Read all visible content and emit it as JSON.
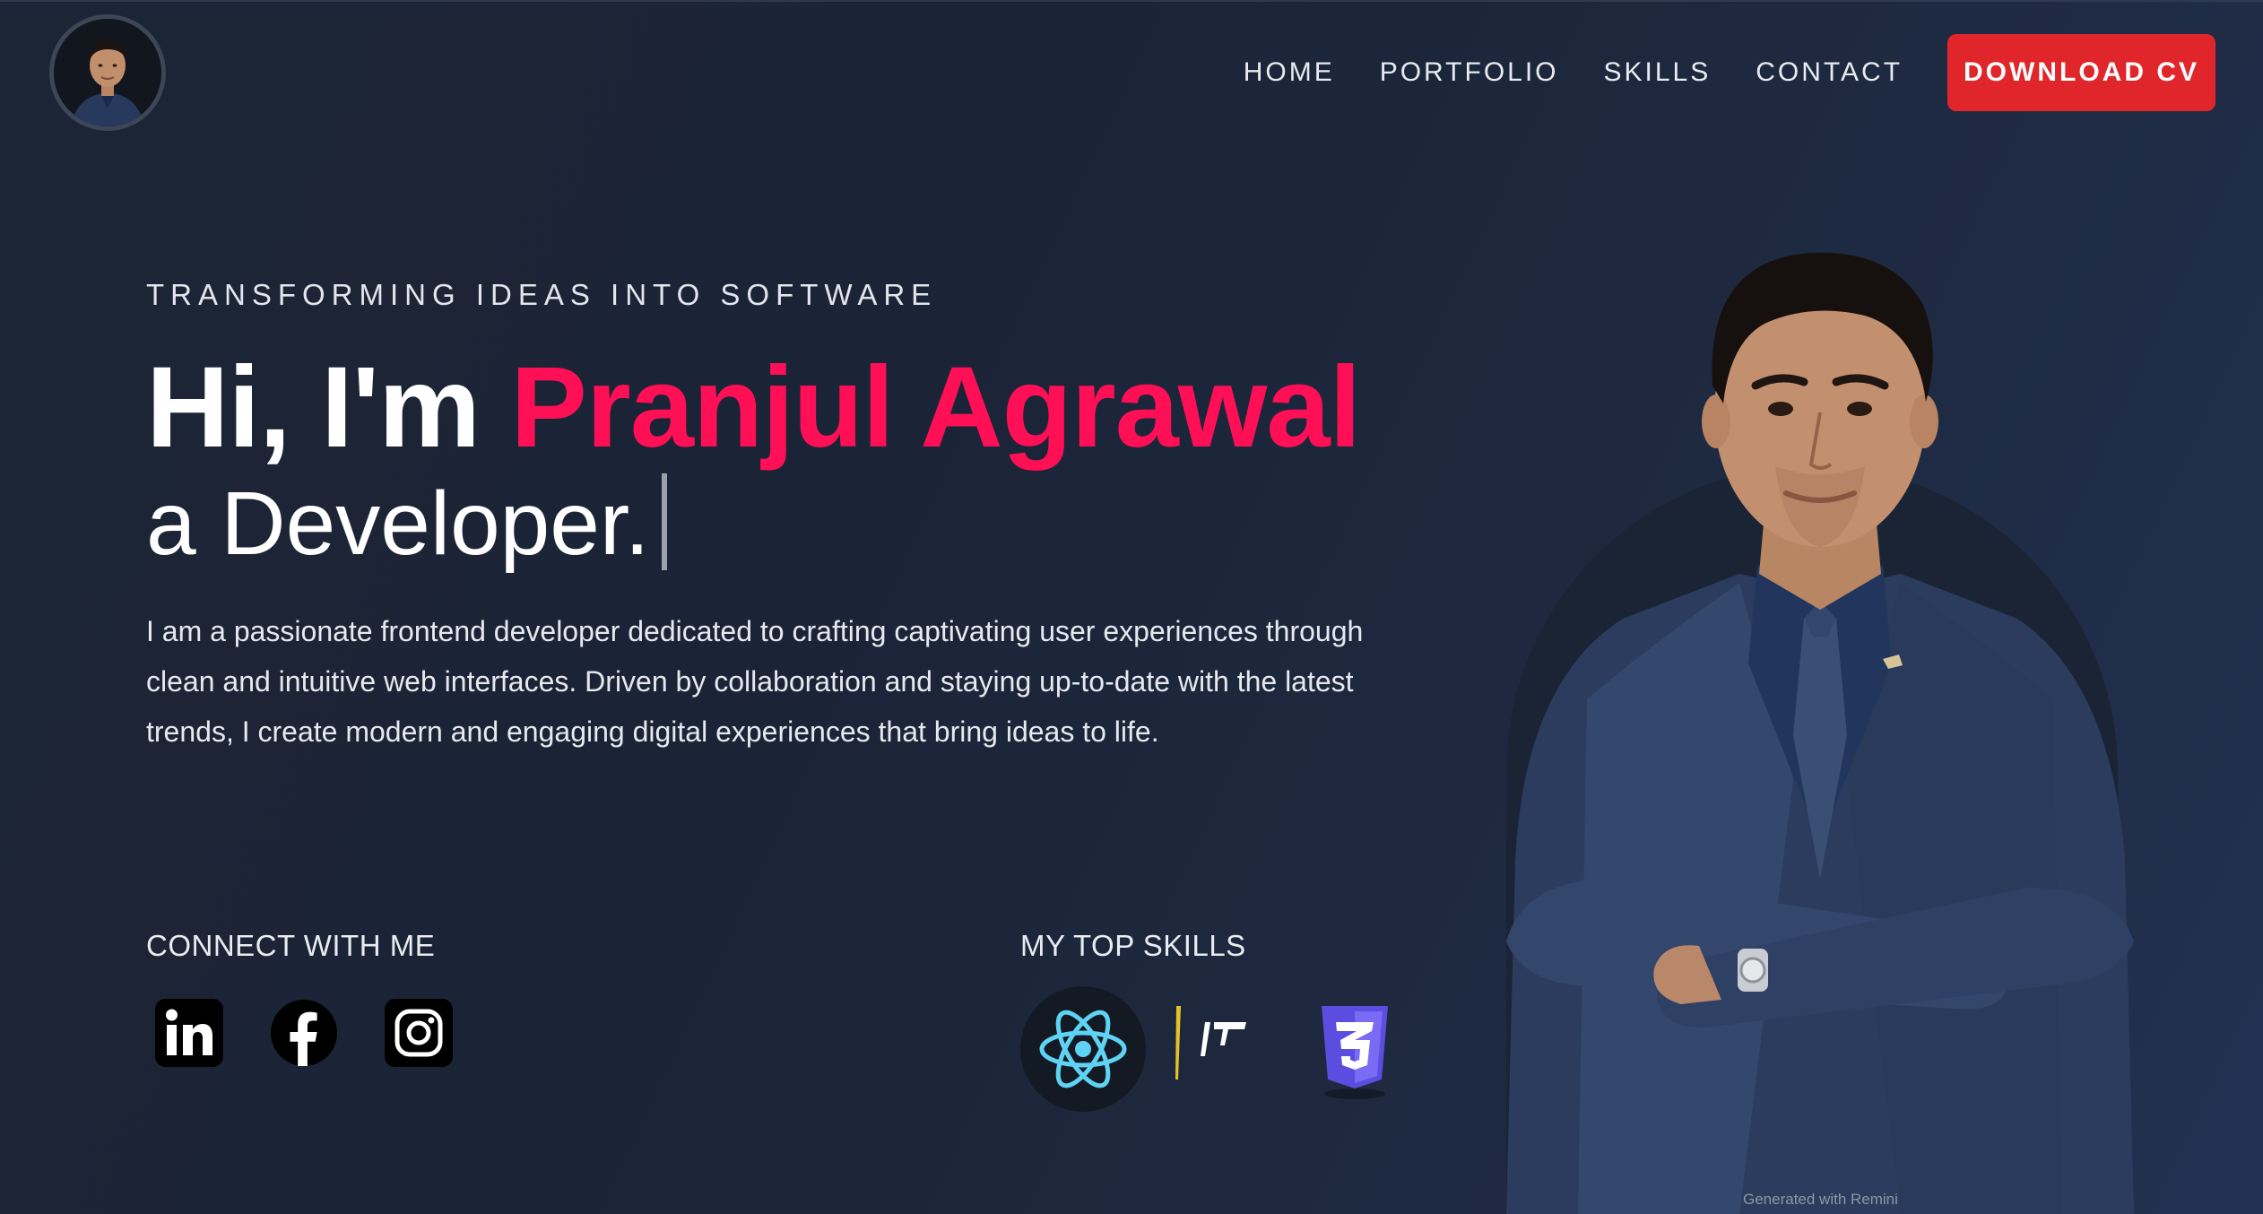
{
  "header": {
    "nav": {
      "home": "HOME",
      "portfolio": "PORTFOLIO",
      "skills": "SKILLS",
      "contact": "CONTACT"
    },
    "cta": "DOWNLOAD CV"
  },
  "hero": {
    "tagline": "TRANSFORMING IDEAS INTO SOFTWARE",
    "greeting": "Hi, I'm ",
    "name": "Pranjul Agrawal",
    "role": "a Developer.",
    "intro": "I am a passionate frontend developer dedicated to crafting captivating user experiences through clean and intuitive web interfaces. Driven by collaboration and staying up-to-date with the latest trends, I create modern and engaging digital experiences that bring ideas to life."
  },
  "connect": {
    "title": "CONNECT WITH ME",
    "icons": [
      "linkedin-icon",
      "facebook-icon",
      "instagram-icon"
    ]
  },
  "skills": {
    "title": "MY TOP SKILLS",
    "icons": [
      "react-icon",
      "nextjs-icon",
      "css3-icon"
    ]
  },
  "watermark": "Generated with Remini",
  "colors": {
    "accent": "#ff0f55",
    "cta": "#e0262b",
    "background": "#1c2535"
  }
}
